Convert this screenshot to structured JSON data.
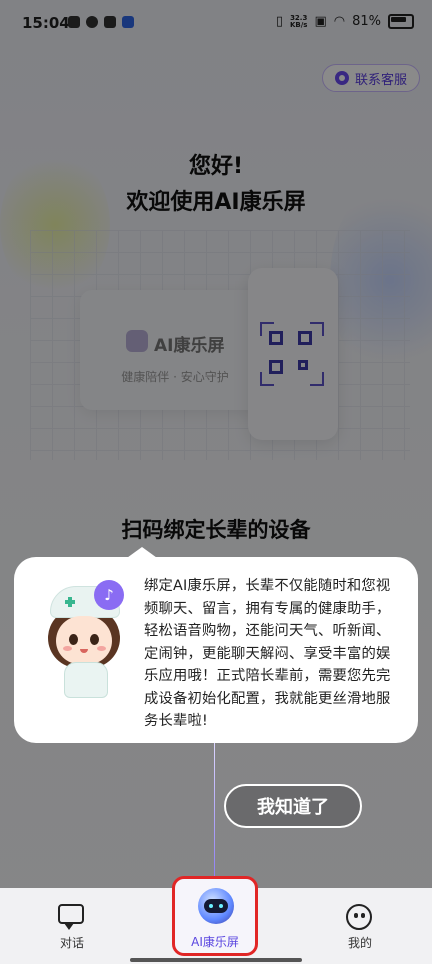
{
  "status_bar": {
    "time": "15:04",
    "network_speed_value": "32.3",
    "network_speed_unit": "KB/s",
    "battery": "81%"
  },
  "header": {
    "service_button": "联系客服"
  },
  "greeting": {
    "line1": "您好!",
    "line2": "欢迎使用AI康乐屏"
  },
  "illustration": {
    "device_name": "AI康乐屏",
    "device_slogan": "健康陪伴 · 安心守护"
  },
  "scan_title": "扫码绑定长辈的设备",
  "popup": {
    "text": "绑定AI康乐屏，长辈不仅能随时和您视频聊天、留言，拥有专属的健康助手，轻松语音购物，还能问天气、听新闻、定闹钟，更能聊天解闷、享受丰富的娱乐应用哦！正式陪长辈前，需要您先完成设备初始化配置，我就能更丝滑地服务长辈啦!",
    "button": "我知道了"
  },
  "bottom_nav": {
    "items": [
      {
        "label": "对话",
        "icon": "chat-icon"
      },
      {
        "label": "AI康乐屏",
        "icon": "robot-icon",
        "active": true
      },
      {
        "label": "我的",
        "icon": "smile-face-icon"
      }
    ]
  },
  "colors": {
    "accent": "#6a4af0",
    "highlight_border": "#e12626"
  }
}
